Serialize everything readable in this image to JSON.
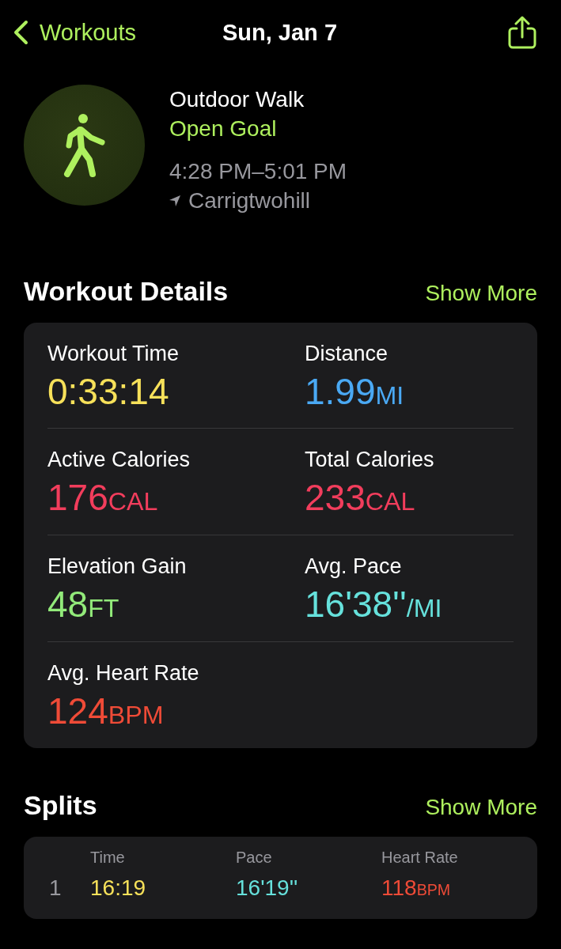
{
  "nav": {
    "back_label": "Workouts",
    "title": "Sun, Jan 7"
  },
  "workout": {
    "type": "Outdoor Walk",
    "goal": "Open Goal",
    "time_range": "4:28 PM–5:01 PM",
    "location": "Carrigtwohill"
  },
  "workout_details": {
    "title": "Workout Details",
    "action": "Show More",
    "rows": [
      {
        "metrics": [
          {
            "label": "Workout Time",
            "value": "0:33:14",
            "color": "#f7e15a"
          },
          {
            "label": "Distance",
            "value": "1.99",
            "unit": "MI",
            "color": "#4aa9f4"
          }
        ]
      },
      {
        "metrics": [
          {
            "label": "Active Calories",
            "value": "176",
            "unit": "CAL",
            "color": "#f23d5c"
          },
          {
            "label": "Total Calories",
            "value": "233",
            "unit": "CAL",
            "color": "#f23d5c"
          }
        ]
      },
      {
        "metrics": [
          {
            "label": "Elevation Gain",
            "value": "48",
            "unit": "FT",
            "color": "#92ea7a"
          },
          {
            "label": "Avg. Pace",
            "value": "16'38''",
            "unit": "/MI",
            "color": "#66e1dc"
          }
        ]
      },
      {
        "metrics": [
          {
            "label": "Avg. Heart Rate",
            "value": "124",
            "unit": "BPM",
            "color": "#ef4b37"
          }
        ]
      }
    ]
  },
  "splits": {
    "title": "Splits",
    "action": "Show More",
    "columns": [
      {
        "label": "Time",
        "color": "#f7e15a"
      },
      {
        "label": "Pace",
        "color": "#66e1dc"
      },
      {
        "label": "Heart Rate",
        "color": "#ef4b37"
      }
    ],
    "rows": [
      {
        "index": "1",
        "cells": [
          {
            "value": "16:19"
          },
          {
            "value": "16'19''"
          },
          {
            "value": "118",
            "unit": "BPM"
          }
        ]
      }
    ]
  }
}
